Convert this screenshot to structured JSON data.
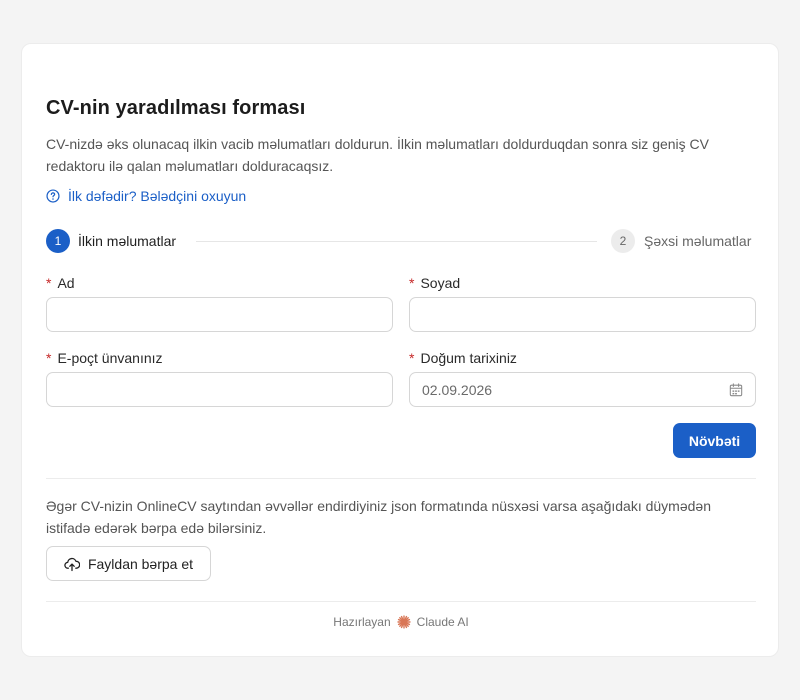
{
  "form": {
    "title": "CV-nin yaradılması forması",
    "description": "CV-nizdə əks olunacaq ilkin vacib məlumatları doldurun. İlkin məlumatları doldurduqdan sonra siz geniş CV redaktoru ilə qalan məlumatları dolduracaqsız.",
    "help_link": "İlk dəfədir? Bələdçini oxuyun"
  },
  "stepper": {
    "steps": [
      {
        "number": "1",
        "label": "İlkin məlumatlar",
        "state": "active"
      },
      {
        "number": "2",
        "label": "Şəxsi məlumatlar",
        "state": "inactive"
      }
    ]
  },
  "fields": {
    "required_marker": "*",
    "first_name": {
      "label": "Ad",
      "value": ""
    },
    "last_name": {
      "label": "Soyad",
      "value": ""
    },
    "email": {
      "label": "E-poçt ünvanınız",
      "value": ""
    },
    "birth_date": {
      "label": "Doğum tarixiniz",
      "value": "02.09.2026"
    }
  },
  "actions": {
    "next_label": "Növbəti",
    "restore_text": "Əgər CV-nizin OnlineCV saytından əvvəllər endirdiyiniz json formatında nüsxəsi varsa aşağıdakı düymədən istifadə edərək bərpa edə bilərsiniz.",
    "restore_button_label": "Fayldan bərpa et"
  },
  "footer": {
    "prefix": "Hazırlayan",
    "brand": "Claude AI"
  },
  "colors": {
    "accent": "#1b5fc7",
    "required": "#c62828",
    "brand_icon": "#d97757"
  },
  "icons": {
    "help": "help-circle-icon",
    "calendar": "calendar-icon",
    "upload": "cloud-upload-icon",
    "brand": "claude-sunburst-icon"
  }
}
